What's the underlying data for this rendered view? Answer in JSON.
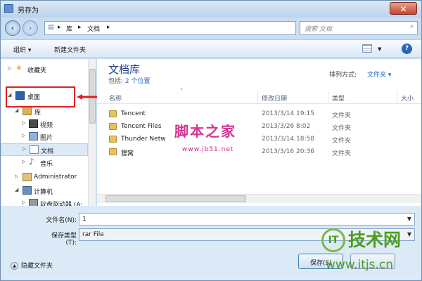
{
  "window": {
    "title": "另存为",
    "close_label": "✕"
  },
  "address": {
    "back_icon": "back-arrow-icon",
    "breadcrumb": [
      "库",
      "文档"
    ],
    "separator": "▸",
    "search_placeholder": "搜索 文档"
  },
  "toolbar": {
    "organize": "组织 ▾",
    "new_folder": "新建文件夹",
    "help": "?"
  },
  "sidebar": {
    "items": [
      {
        "label": "收藏夹",
        "arrow": "▷",
        "icon": "star-icon"
      },
      {
        "label": "桌面",
        "arrow": "◢",
        "icon": "desktop-icon"
      },
      {
        "label": "库",
        "arrow": "◢",
        "icon": "library-icon"
      },
      {
        "label": "视频",
        "arrow": "▷",
        "icon": "video-icon"
      },
      {
        "label": "图片",
        "arrow": "▷",
        "icon": "picture-icon"
      },
      {
        "label": "文档",
        "arrow": "▷",
        "icon": "document-icon"
      },
      {
        "label": "音乐",
        "arrow": "▷",
        "icon": "music-icon"
      },
      {
        "label": "Administrator",
        "arrow": "▷",
        "icon": "user-icon"
      },
      {
        "label": "计算机",
        "arrow": "◢",
        "icon": "computer-icon"
      },
      {
        "label": "软盘驱动器 (A:",
        "arrow": "▷",
        "icon": "floppy-icon"
      }
    ]
  },
  "main": {
    "library_title": "文档库",
    "includes_label": "包括:",
    "includes_link": "2 个位置",
    "sort_label": "排列方式:",
    "sort_value": "文件夹 ▾",
    "columns": [
      "名称",
      "修改日期",
      "类型",
      "大小"
    ],
    "files": [
      {
        "name": "Tencent",
        "date": "2013/3/14 19:15",
        "type": "文件夹"
      },
      {
        "name": "Tencent Files",
        "date": "2013/3/26 8:02",
        "type": "文件夹"
      },
      {
        "name": "Thunder Netw",
        "date": "2013/3/14 18:58",
        "type": "文件夹"
      },
      {
        "name": "狸窝",
        "date": "2013/3/16 20:36",
        "type": "文件夹"
      }
    ]
  },
  "form": {
    "filename_label": "文件名(N):",
    "filename_value": "1",
    "filetype_label": "保存类型(T):",
    "filetype_value": "rar File"
  },
  "buttons": {
    "hide_folders": "隐藏文件夹",
    "save": "保存(S)"
  },
  "watermarks": {
    "jb51_text": "脚本之家",
    "jb51_url": "www.jb51.net",
    "itjs_logo": "IT",
    "itjs_text": "技术网",
    "itjs_url": "www.itjs.cn"
  },
  "colors": {
    "accent": "#2164c4",
    "highlight": "#e01d1d",
    "watermark_pink": "#d11f8a",
    "watermark_green": "#4c9e1f"
  }
}
